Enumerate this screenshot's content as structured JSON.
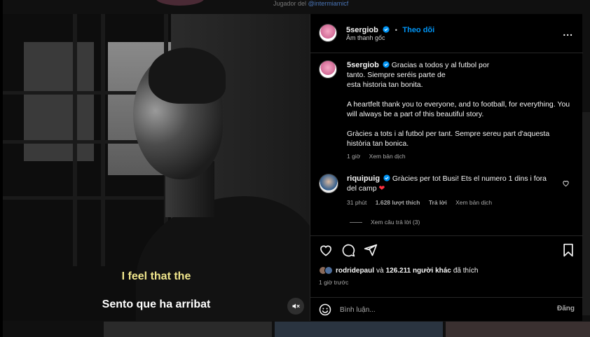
{
  "background": {
    "top_text": "Jugador del",
    "top_handle": "@intermiamicf"
  },
  "video": {
    "caption_line1": "I feel that the",
    "caption_line2": "Sento que ha arribat",
    "mute_icon": "speaker-muted-icon"
  },
  "post": {
    "username": "5sergiob",
    "follow_label": "Theo dõi",
    "separator": "•",
    "audio_label": "Âm thanh gốc",
    "more_label": "..."
  },
  "caption": {
    "username": "5sergiob",
    "text_es": "Gracias a todos y al futbol por tanto. Siempre seréis parte de esta historia tan bonita.",
    "text_es_line1": "Gracias a todos y al futbol por",
    "text_es_line2": "tanto. Siempre seréis parte de",
    "text_es_line3": "esta historia tan bonita.",
    "text_en": "A heartfelt thank you to everyone, and to football, for everything. You will always be a part of this beautiful story.",
    "text_ca": "Gràcies a tots i al futbol per tant. Sempre sereu part d'aquesta història tan bonica.",
    "time": "1 giờ",
    "translate": "Xem bản dịch"
  },
  "comment": {
    "username": "riquipuig",
    "text": "Gràcies per tot Busi! Ets el numero 1 dins i fora del camp",
    "heart_emoji": "❤",
    "time": "31 phút",
    "likes": "1.628 lượt thích",
    "reply": "Trả lời",
    "translate": "Xem bản dịch",
    "view_replies": "Xem câu trả lời (3)"
  },
  "actions": {
    "icons": [
      "heart-icon",
      "comment-icon",
      "share-icon",
      "bookmark-icon"
    ]
  },
  "likes": {
    "first_user": "rodridepaul",
    "connector": "và",
    "others": "126.211 người khác",
    "suffix": "đã thích",
    "time_ago": "1 giờ trước"
  },
  "add_comment": {
    "placeholder": "Bình luận...",
    "post_label": "Đăng"
  },
  "colors": {
    "accent": "#0095f6",
    "caption_yellow": "#f0e68c",
    "heart_red": "#ff3040"
  }
}
